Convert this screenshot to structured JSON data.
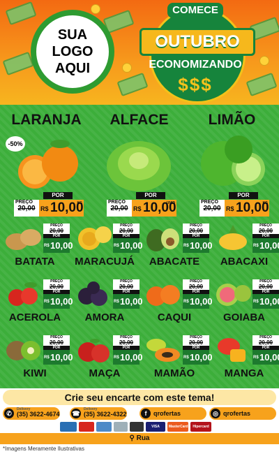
{
  "header": {
    "logo_lines": [
      "SUA",
      "LOGO",
      "AQUI"
    ],
    "seal_top": "COMECE",
    "seal_month": "OUTUBRO",
    "seal_bottom": "ECONOMIZANDO",
    "seal_symbols": "$$$"
  },
  "featured": [
    {
      "name": "LARANJA",
      "discount": "-50%",
      "old_label": "PREÇO",
      "old_price": "20,00",
      "por": "POR",
      "currency": "R$",
      "price": "10,00",
      "unit": "KG",
      "icon": "orange-icon"
    },
    {
      "name": "ALFACE",
      "discount": "",
      "old_label": "PREÇO",
      "old_price": "20,00",
      "por": "POR",
      "currency": "R$",
      "price": "10,00",
      "unit": "UNID",
      "icon": "lettuce-icon"
    },
    {
      "name": "LIMÃO",
      "discount": "",
      "old_label": "PREÇO",
      "old_price": "20,00",
      "por": "POR",
      "currency": "R$",
      "price": "10,00",
      "unit": "KG",
      "icon": "lime-icon"
    }
  ],
  "products": [
    {
      "name": "BATATA",
      "old_label": "PREÇO",
      "old_price": "20,00",
      "por": "POR",
      "currency": "R$",
      "price": "10,00",
      "icon": "potato-icon"
    },
    {
      "name": "MARACUJÁ",
      "old_label": "PREÇO",
      "old_price": "20,00",
      "por": "POR",
      "currency": "R$",
      "price": "10,00",
      "icon": "passionfruit-icon"
    },
    {
      "name": "ABACATE",
      "old_label": "PREÇO",
      "old_price": "20,00",
      "por": "POR",
      "currency": "R$",
      "price": "10,00",
      "icon": "avocado-icon"
    },
    {
      "name": "ABACAXI",
      "old_label": "PREÇO",
      "old_price": "20,00",
      "por": "POR",
      "currency": "R$",
      "price": "10,00",
      "icon": "pineapple-icon"
    },
    {
      "name": "ACEROLA",
      "old_label": "PREÇO",
      "old_price": "20,00",
      "por": "POR",
      "currency": "R$",
      "price": "10,00",
      "icon": "acerola-icon"
    },
    {
      "name": "AMORA",
      "old_label": "PREÇO",
      "old_price": "20,00",
      "por": "POR",
      "currency": "R$",
      "price": "10,00",
      "icon": "blackberry-icon"
    },
    {
      "name": "CAQUI",
      "old_label": "PREÇO",
      "old_price": "20,00",
      "por": "POR",
      "currency": "R$",
      "price": "10,00",
      "icon": "persimmon-icon"
    },
    {
      "name": "GOIABA",
      "old_label": "PREÇO",
      "old_price": "20,00",
      "por": "POR",
      "currency": "R$",
      "price": "10,00",
      "icon": "guava-icon"
    },
    {
      "name": "KIWI",
      "old_label": "PREÇO",
      "old_price": "20,00",
      "por": "POR",
      "currency": "R$",
      "price": "10,00",
      "icon": "kiwi-icon"
    },
    {
      "name": "MAÇA",
      "old_label": "PREÇO",
      "old_price": "20,00",
      "por": "POR",
      "currency": "R$",
      "price": "10,00",
      "icon": "apple-icon"
    },
    {
      "name": "MAMÃO",
      "old_label": "PREÇO",
      "old_price": "20,00",
      "por": "POR",
      "currency": "R$",
      "price": "10,00",
      "icon": "papaya-icon"
    },
    {
      "name": "MANGA",
      "old_label": "PREÇO",
      "old_price": "20,00",
      "por": "POR",
      "currency": "R$",
      "price": "10,00",
      "icon": "mango-icon"
    }
  ],
  "footer": {
    "cta": "Crie seu encarte com este tema!",
    "contacts": [
      {
        "icon": "whatsapp-icon",
        "label": "Delivery",
        "text": "(35) 3622-4674"
      },
      {
        "icon": "phone-icon",
        "label": "Delivery",
        "text": "(35) 3622-4322"
      },
      {
        "icon": "facebook-icon",
        "label": "",
        "text": "qrofertas"
      },
      {
        "icon": "instagram-icon",
        "label": "",
        "text": "qrofertas"
      }
    ],
    "payments": [
      "VISA",
      "MasterCard",
      "Hipercard"
    ],
    "address": "Rua",
    "disclaimer": "*Imagens Meramente Ilustrativas"
  }
}
